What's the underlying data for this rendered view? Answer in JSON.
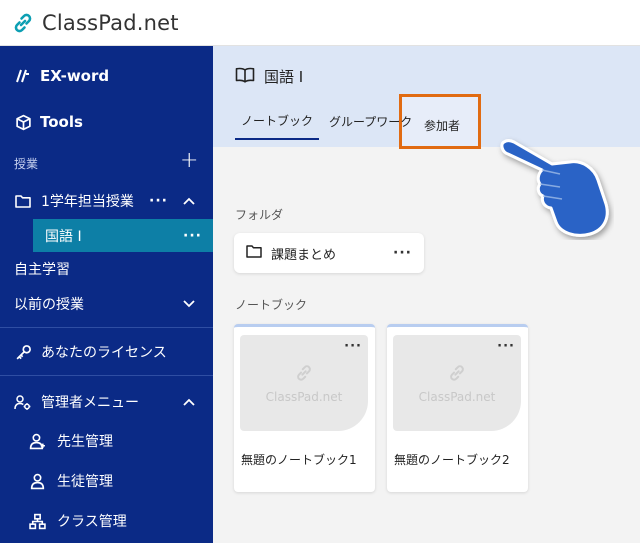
{
  "app": {
    "logo_text": "ClassPad.net"
  },
  "sidebar": {
    "exword": "EX-word",
    "tools": "Tools",
    "classes_label": "授業",
    "add_symbol": "+",
    "course_group": "1学年担当授業",
    "selected_course": "国語 I",
    "self_study": "自主学習",
    "past_classes": "以前の授業",
    "license": "あなたのライセンス",
    "admin_menu": "管理者メニュー",
    "teacher_mgmt": "先生管理",
    "student_mgmt": "生徒管理",
    "class_mgmt": "クラス管理",
    "more_symbol": "···"
  },
  "course": {
    "title": "国語 I",
    "tabs": [
      "ノートブック",
      "グループワーク",
      "参加者"
    ]
  },
  "folders": {
    "label": "フォルダ",
    "items": [
      {
        "name": "課題まとめ"
      }
    ]
  },
  "notebooks": {
    "label": "ノートブック",
    "watermark": "ClassPad.net",
    "items": [
      {
        "title": "無題のノートブック1"
      },
      {
        "title": "無題のノートブック2"
      }
    ]
  },
  "colors": {
    "sidebar_bg": "#0b2a86",
    "selected_bg": "#0d7fa6",
    "highlight_border": "#e16b12",
    "hand": "#2a63c6"
  }
}
